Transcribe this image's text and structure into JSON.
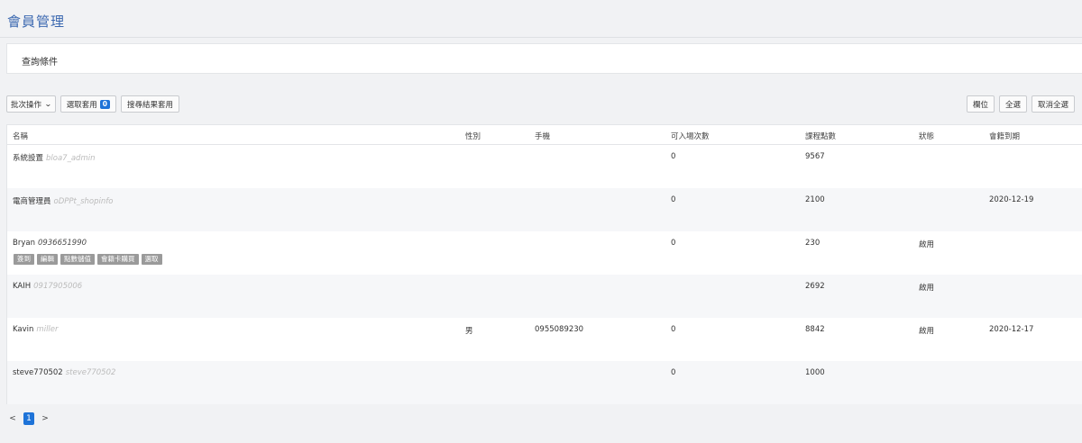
{
  "page": {
    "title": "會員管理"
  },
  "query": {
    "title": "查詢條件"
  },
  "toolbar": {
    "batch_label": "批次操作",
    "select_apply_label": "選取套用",
    "select_count": "0",
    "search_apply_label": "搜尋結果套用",
    "columns_label": "欄位",
    "select_all_label": "全選",
    "deselect_all_label": "取消全選"
  },
  "table": {
    "headers": [
      "名稱",
      "性別",
      "手機",
      "可入場次數",
      "課程點數",
      "狀態",
      "會籍到期"
    ],
    "rows": [
      {
        "name": "系統設置",
        "sub": "bloa7_admin",
        "gender": "",
        "phone": "",
        "entries": "0",
        "points": "9567",
        "status": "",
        "expiry": ""
      },
      {
        "name": "電商管理員",
        "sub": "oDPPt_shopinfo",
        "gender": "",
        "phone": "",
        "entries": "0",
        "points": "2100",
        "status": "",
        "expiry": "2020-12-19"
      },
      {
        "name": "Bryan",
        "sub": "0936651990",
        "gender": "",
        "phone": "",
        "entries": "0",
        "points": "230",
        "status": "啟用",
        "expiry": "",
        "actions": [
          "簽到",
          "編輯",
          "點數儲值",
          "會籍卡購買",
          "選取"
        ]
      },
      {
        "name": "KAIH",
        "sub": "0917905006",
        "gender": "",
        "phone": "",
        "entries": "",
        "points": "2692",
        "status": "啟用",
        "expiry": ""
      },
      {
        "name": "Kavin",
        "sub": "miller",
        "gender": "男",
        "phone": "0955089230",
        "entries": "0",
        "points": "8842",
        "status": "啟用",
        "expiry": "2020-12-17"
      },
      {
        "name": "steve770502",
        "sub": "steve770502",
        "gender": "",
        "phone": "",
        "entries": "0",
        "points": "1000",
        "status": "",
        "expiry": ""
      }
    ]
  },
  "pagination": {
    "prev": "<",
    "current": "1",
    "next": ">"
  },
  "colors": {
    "accent": "#1e73d8",
    "title": "#3b68b0",
    "action_tag": "#9a9a9a"
  }
}
